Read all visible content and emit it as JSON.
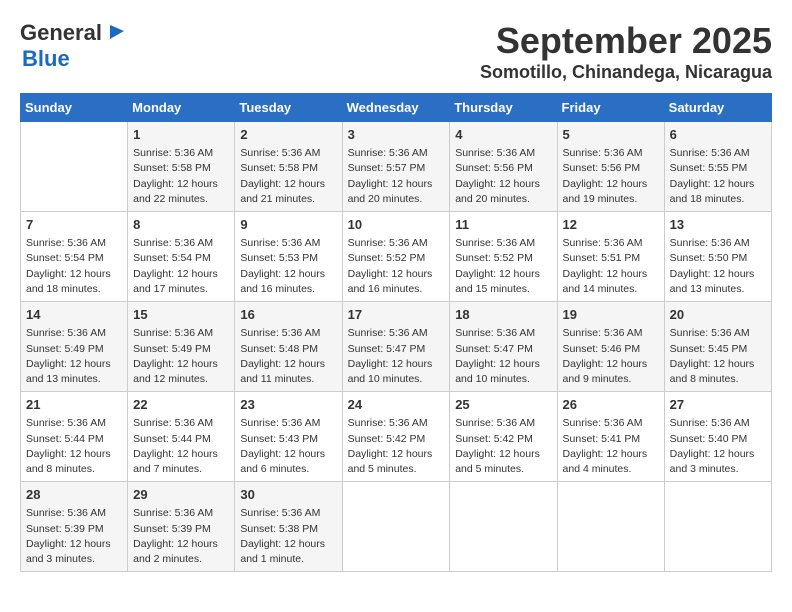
{
  "header": {
    "logo_general": "General",
    "logo_blue": "Blue",
    "month_year": "September 2025",
    "location": "Somotillo, Chinandega, Nicaragua"
  },
  "days_of_week": [
    "Sunday",
    "Monday",
    "Tuesday",
    "Wednesday",
    "Thursday",
    "Friday",
    "Saturday"
  ],
  "weeks": [
    [
      {
        "day": "",
        "sunrise": "",
        "sunset": "",
        "daylight": ""
      },
      {
        "day": "1",
        "sunrise": "5:36 AM",
        "sunset": "5:58 PM",
        "daylight": "12 hours and 22 minutes."
      },
      {
        "day": "2",
        "sunrise": "5:36 AM",
        "sunset": "5:58 PM",
        "daylight": "12 hours and 21 minutes."
      },
      {
        "day": "3",
        "sunrise": "5:36 AM",
        "sunset": "5:57 PM",
        "daylight": "12 hours and 20 minutes."
      },
      {
        "day": "4",
        "sunrise": "5:36 AM",
        "sunset": "5:56 PM",
        "daylight": "12 hours and 20 minutes."
      },
      {
        "day": "5",
        "sunrise": "5:36 AM",
        "sunset": "5:56 PM",
        "daylight": "12 hours and 19 minutes."
      },
      {
        "day": "6",
        "sunrise": "5:36 AM",
        "sunset": "5:55 PM",
        "daylight": "12 hours and 18 minutes."
      }
    ],
    [
      {
        "day": "7",
        "sunrise": "5:36 AM",
        "sunset": "5:54 PM",
        "daylight": "12 hours and 18 minutes."
      },
      {
        "day": "8",
        "sunrise": "5:36 AM",
        "sunset": "5:54 PM",
        "daylight": "12 hours and 17 minutes."
      },
      {
        "day": "9",
        "sunrise": "5:36 AM",
        "sunset": "5:53 PM",
        "daylight": "12 hours and 16 minutes."
      },
      {
        "day": "10",
        "sunrise": "5:36 AM",
        "sunset": "5:52 PM",
        "daylight": "12 hours and 16 minutes."
      },
      {
        "day": "11",
        "sunrise": "5:36 AM",
        "sunset": "5:52 PM",
        "daylight": "12 hours and 15 minutes."
      },
      {
        "day": "12",
        "sunrise": "5:36 AM",
        "sunset": "5:51 PM",
        "daylight": "12 hours and 14 minutes."
      },
      {
        "day": "13",
        "sunrise": "5:36 AM",
        "sunset": "5:50 PM",
        "daylight": "12 hours and 13 minutes."
      }
    ],
    [
      {
        "day": "14",
        "sunrise": "5:36 AM",
        "sunset": "5:49 PM",
        "daylight": "12 hours and 13 minutes."
      },
      {
        "day": "15",
        "sunrise": "5:36 AM",
        "sunset": "5:49 PM",
        "daylight": "12 hours and 12 minutes."
      },
      {
        "day": "16",
        "sunrise": "5:36 AM",
        "sunset": "5:48 PM",
        "daylight": "12 hours and 11 minutes."
      },
      {
        "day": "17",
        "sunrise": "5:36 AM",
        "sunset": "5:47 PM",
        "daylight": "12 hours and 10 minutes."
      },
      {
        "day": "18",
        "sunrise": "5:36 AM",
        "sunset": "5:47 PM",
        "daylight": "12 hours and 10 minutes."
      },
      {
        "day": "19",
        "sunrise": "5:36 AM",
        "sunset": "5:46 PM",
        "daylight": "12 hours and 9 minutes."
      },
      {
        "day": "20",
        "sunrise": "5:36 AM",
        "sunset": "5:45 PM",
        "daylight": "12 hours and 8 minutes."
      }
    ],
    [
      {
        "day": "21",
        "sunrise": "5:36 AM",
        "sunset": "5:44 PM",
        "daylight": "12 hours and 8 minutes."
      },
      {
        "day": "22",
        "sunrise": "5:36 AM",
        "sunset": "5:44 PM",
        "daylight": "12 hours and 7 minutes."
      },
      {
        "day": "23",
        "sunrise": "5:36 AM",
        "sunset": "5:43 PM",
        "daylight": "12 hours and 6 minutes."
      },
      {
        "day": "24",
        "sunrise": "5:36 AM",
        "sunset": "5:42 PM",
        "daylight": "12 hours and 5 minutes."
      },
      {
        "day": "25",
        "sunrise": "5:36 AM",
        "sunset": "5:42 PM",
        "daylight": "12 hours and 5 minutes."
      },
      {
        "day": "26",
        "sunrise": "5:36 AM",
        "sunset": "5:41 PM",
        "daylight": "12 hours and 4 minutes."
      },
      {
        "day": "27",
        "sunrise": "5:36 AM",
        "sunset": "5:40 PM",
        "daylight": "12 hours and 3 minutes."
      }
    ],
    [
      {
        "day": "28",
        "sunrise": "5:36 AM",
        "sunset": "5:39 PM",
        "daylight": "12 hours and 3 minutes."
      },
      {
        "day": "29",
        "sunrise": "5:36 AM",
        "sunset": "5:39 PM",
        "daylight": "12 hours and 2 minutes."
      },
      {
        "day": "30",
        "sunrise": "5:36 AM",
        "sunset": "5:38 PM",
        "daylight": "12 hours and 1 minute."
      },
      {
        "day": "",
        "sunrise": "",
        "sunset": "",
        "daylight": ""
      },
      {
        "day": "",
        "sunrise": "",
        "sunset": "",
        "daylight": ""
      },
      {
        "day": "",
        "sunrise": "",
        "sunset": "",
        "daylight": ""
      },
      {
        "day": "",
        "sunrise": "",
        "sunset": "",
        "daylight": ""
      }
    ]
  ]
}
